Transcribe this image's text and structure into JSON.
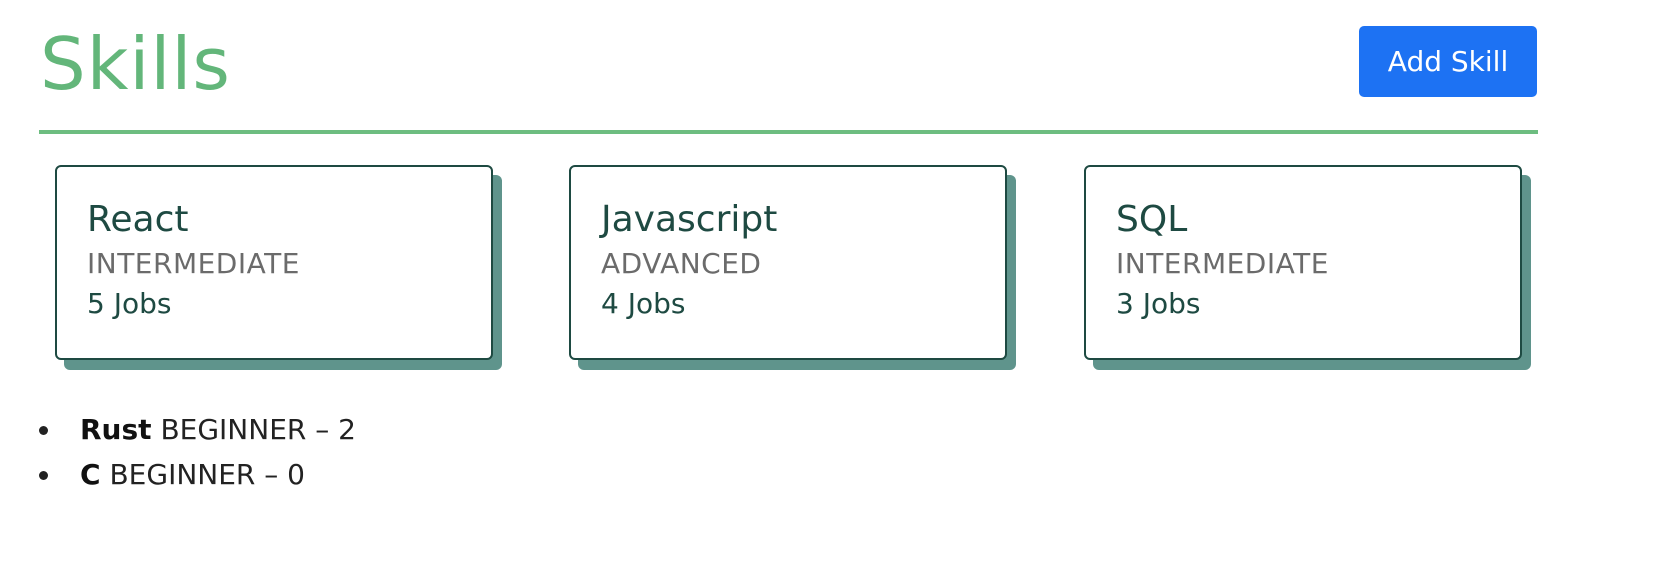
{
  "header": {
    "title": "Skills",
    "add_button_label": "Add Skill"
  },
  "colors": {
    "title": "#63b67a",
    "accent_button": "#1d72f3",
    "card_border": "#1e4a42",
    "card_shadow": "#5f948c"
  },
  "cards": [
    {
      "name": "React",
      "level": "INTERMEDIATE",
      "jobs": "5 Jobs"
    },
    {
      "name": "Javascript",
      "level": "ADVANCED",
      "jobs": "4 Jobs"
    },
    {
      "name": "SQL",
      "level": "INTERMEDIATE",
      "jobs": "3 Jobs"
    }
  ],
  "list": [
    {
      "name": "Rust",
      "detail": "BEGINNER – 2"
    },
    {
      "name": "C",
      "detail": "BEGINNER – 0"
    }
  ]
}
